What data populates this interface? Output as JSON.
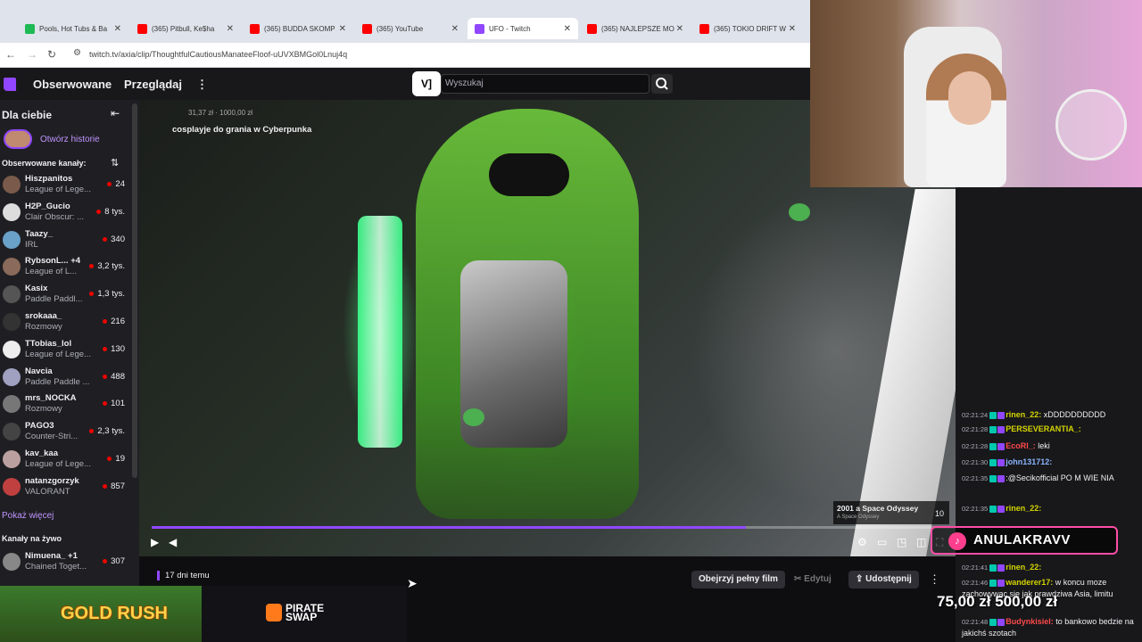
{
  "tabs": [
    {
      "title": "Pools, Hot Tubs & Ba",
      "color": "#1db954"
    },
    {
      "title": "(365) Pitbull, Ke$ha",
      "color": "#ff0000"
    },
    {
      "title": "(365) BUDDA SKOMP",
      "color": "#ff0000"
    },
    {
      "title": "(365) YouTube",
      "color": "#ff0000"
    },
    {
      "title": "UFO - Twitch",
      "color": "#9147ff"
    },
    {
      "title": "(365) NAJLEPSZE MO",
      "color": "#ff0000"
    },
    {
      "title": "(365) TOKIO DRIFT W",
      "color": "#ff0000"
    }
  ],
  "url": "twitch.tv/axia/clip/ThoughtfulCautiousManateeFloof-uUVXBMGol0Lnuj4q",
  "nav": {
    "following": "Obserwowane",
    "browse": "Przeglądaj",
    "more": "⋮",
    "search_placeholder": "Wyszukaj"
  },
  "sidebar": {
    "for_you": "Dla ciebie",
    "collapse": "⇤",
    "stories": "Otwórz historie",
    "followed": "Obserwowane kanały:",
    "show_more": "Pokaż więcej",
    "live_channels": "Kanały na żywo",
    "channels": [
      {
        "name": "Hiszpanitos",
        "game": "League of Lege...",
        "viewers": "24",
        "color": "#7a5a4a"
      },
      {
        "name": "H2P_Gucio",
        "game": "Clair Obscur: ...",
        "viewers": "8 tys.",
        "color": "#dddddd"
      },
      {
        "name": "Taazy_",
        "game": "IRL",
        "viewers": "340",
        "color": "#6aa1c9"
      },
      {
        "name": "RybsonL... +4",
        "game": "League of L...",
        "viewers": "3,2 tys.",
        "color": "#8a6a5a"
      },
      {
        "name": "Kasix",
        "game": "Paddle Paddl...",
        "viewers": "1,3 tys.",
        "color": "#555555"
      },
      {
        "name": "srokaaa_",
        "game": "Rozmowy",
        "viewers": "216",
        "color": "#333333"
      },
      {
        "name": "TTobias_lol",
        "game": "League of Lege...",
        "viewers": "130",
        "color": "#eeeeee"
      },
      {
        "name": "Navcia",
        "game": "Paddle Paddle ...",
        "viewers": "488",
        "color": "#a0a0c0"
      },
      {
        "name": "mrs_NOCKA",
        "game": "Rozmowy",
        "viewers": "101",
        "color": "#777777"
      },
      {
        "name": "PAGO3",
        "game": "Counter-Stri...",
        "viewers": "2,3 tys.",
        "color": "#444444"
      },
      {
        "name": "kav_kaa",
        "game": "League of Lege...",
        "viewers": "19",
        "color": "#bba0a0"
      },
      {
        "name": "natanzgorzyk",
        "game": "VALORANT",
        "viewers": "857",
        "color": "#c04040"
      }
    ],
    "live": [
      {
        "name": "Nimuena_ +1",
        "game": "Chained Toget...",
        "viewers": "307",
        "color": "#888888"
      }
    ]
  },
  "video": {
    "stats": "31,37 zł  ·  1000,00 zł",
    "title": "cosplayje do grania w Cyberpunka",
    "progress": 0.74,
    "song_title": "2001 a Space Odyssey",
    "song_sub": "A Space Odyssey",
    "song_num": "10"
  },
  "below": {
    "age": "17 dni temu",
    "watch_full": "Obejrzyj pełny film",
    "edit": "Edytuj",
    "share": "Udostępnij",
    "more": "⋮"
  },
  "ads": {
    "gold_rush": "GOLD RUSH",
    "pirate_swap_1": "PIRATE",
    "pirate_swap_2": "SWAP"
  },
  "chat": [
    {
      "ts": "02:21:24",
      "user": "rinen_22:",
      "text": " xDDDDDDDDDD",
      "ucolor": "#d4d400"
    },
    {
      "ts": "02:21:28",
      "user": "PERSEVERANTIA_:",
      "text": "",
      "ucolor": "#d4d400"
    },
    {
      "ts": "02:21:28",
      "user": "EcoRl_:",
      "text": " leki",
      "ucolor": "#ff4a4a"
    },
    {
      "ts": "02:21:30",
      "user": "john131712:",
      "text": "",
      "ucolor": "#8ab4ff"
    },
    {
      "ts": "02:21:35",
      "user": "",
      "text": ":@Secikofficial PO M WIE NIA",
      "ucolor": "#8ab4ff"
    },
    {
      "ts": "02:21:35",
      "user": "rinen_22:",
      "text": "",
      "ucolor": "#d4d400"
    },
    {
      "ts": "02:21:41",
      "user": "rinen_22:",
      "text": "",
      "ucolor": "#d4d400"
    },
    {
      "ts": "02:21:46",
      "user": "wanderer17:",
      "text": " w koncu moze zachowywac sie jak prawdziwa Asia, limitu",
      "ucolor": "#d4d400"
    },
    {
      "ts": "02:21:48",
      "user": "Budynkisiel:",
      "text": " to bankowo bedzie na jakichś szotach",
      "ucolor": "#ff4a4a"
    }
  ],
  "overlay": {
    "tiktok_name": "ANULAKRAVV",
    "amounts": "75,00 zł  500,00 zł"
  }
}
